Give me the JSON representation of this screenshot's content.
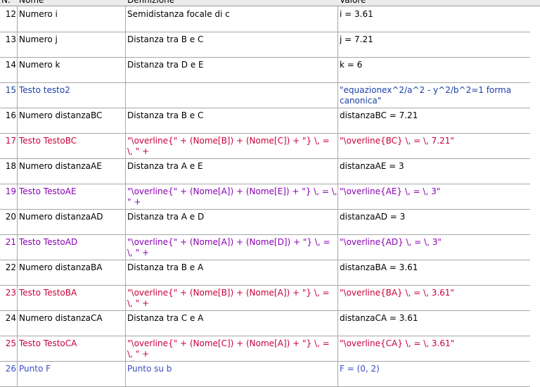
{
  "header": {
    "num": "N.",
    "name": "Nome",
    "def": "Definizione",
    "val": "Valore"
  },
  "rows": [
    {
      "n": "12",
      "name": "Numero i",
      "def": "Semidistanza focale di c",
      "val": "i = 3.61",
      "color": "#000000"
    },
    {
      "n": "13",
      "name": "Numero j",
      "def": "Distanza tra B e C",
      "val": "j = 7.21",
      "color": "#000000"
    },
    {
      "n": "14",
      "name": "Numero k",
      "def": "Distanza tra D e E",
      "val": "k = 6",
      "color": "#000000"
    },
    {
      "n": "15",
      "name": "Testo testo2",
      "def": "",
      "val": "\"equazionex^2/a^2 - y^2/b^2=1 forma canonica\"",
      "color": "#1a3fa8"
    },
    {
      "n": "16",
      "name": "Numero distanzaBC",
      "def": "Distanza tra B e C",
      "val": "distanzaBC = 7.21",
      "color": "#000000"
    },
    {
      "n": "17",
      "name": "Testo TestoBC",
      "def": "\"\\overline{\" + (Nome[B]) + (Nome[C]) + \"} \\, = \\, \" +\ndistanzaBC",
      "val": "\"\\overline{BC} \\, = \\, 7.21\"",
      "color": "#c8003c"
    },
    {
      "n": "18",
      "name": "Numero distanzaAE",
      "def": "Distanza tra A e E",
      "val": "distanzaAE = 3",
      "color": "#000000"
    },
    {
      "n": "19",
      "name": "Testo TestoAE",
      "def": "\"\\overline{\" + (Nome[A]) + (Nome[E]) + \"} \\, = \\, \" +\ndistanzaAE",
      "val": "\"\\overline{AE} \\, = \\, 3\"",
      "color": "#8a00b4"
    },
    {
      "n": "20",
      "name": "Numero distanzaAD",
      "def": "Distanza tra A e D",
      "val": "distanzaAD = 3",
      "color": "#000000"
    },
    {
      "n": "21",
      "name": "Testo TestoAD",
      "def": "\"\\overline{\" + (Nome[A]) + (Nome[D]) + \"} \\, = \\, \" +\ndistanzaAD",
      "val": "\"\\overline{AD} \\, = \\, 3\"",
      "color": "#8a00b4"
    },
    {
      "n": "22",
      "name": "Numero distanzaBA",
      "def": "Distanza tra B e A",
      "val": "distanzaBA = 3.61",
      "color": "#000000"
    },
    {
      "n": "23",
      "name": "Testo TestoBA",
      "def": "\"\\overline{\" + (Nome[B]) + (Nome[A]) + \"} \\, = \\, \" +\ndistanzaBA",
      "val": "\"\\overline{BA} \\, = \\, 3.61\"",
      "color": "#c8003c"
    },
    {
      "n": "24",
      "name": "Numero distanzaCA",
      "def": "Distanza tra C e A",
      "val": "distanzaCA = 3.61",
      "color": "#000000"
    },
    {
      "n": "25",
      "name": "Testo TestoCA",
      "def": "\"\\overline{\" + (Nome[C]) + (Nome[A]) + \"} \\, = \\, \" +\ndistanzaCA",
      "val": "\"\\overline{CA} \\, = \\, 3.61\"",
      "color": "#c8003c"
    },
    {
      "n": "26",
      "name": "Punto F",
      "def": "Punto su b",
      "val": "F = (0, 2)",
      "color": "#3a4bc8"
    }
  ]
}
